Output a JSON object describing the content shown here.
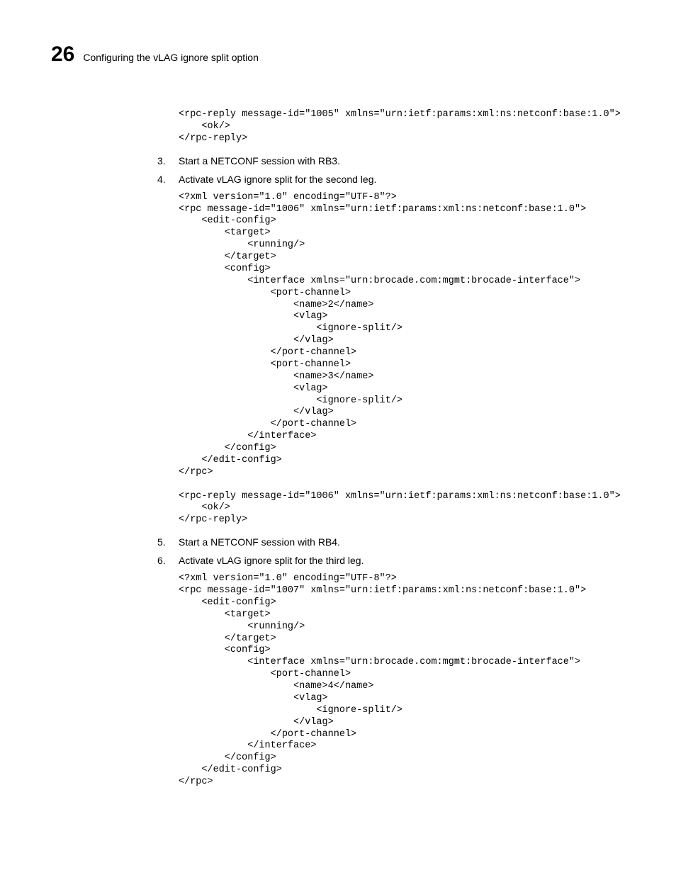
{
  "header": {
    "chapter_number": "26",
    "chapter_title": "Configuring the vLAG ignore split option"
  },
  "code_block_1": "<rpc-reply message-id=\"1005\" xmlns=\"urn:ietf:params:xml:ns:netconf:base:1.0\">\n    <ok/>\n</rpc-reply>",
  "step3": {
    "num": "3.",
    "text": "Start a NETCONF session with RB3."
  },
  "step4": {
    "num": "4.",
    "text": "Activate vLAG ignore split for the second leg."
  },
  "code_block_2": "<?xml version=\"1.0\" encoding=\"UTF-8\"?>\n<rpc message-id=\"1006\" xmlns=\"urn:ietf:params:xml:ns:netconf:base:1.0\">\n    <edit-config>\n        <target>\n            <running/>\n        </target>\n        <config>\n            <interface xmlns=\"urn:brocade.com:mgmt:brocade-interface\">\n                <port-channel>\n                    <name>2</name>\n                    <vlag>\n                        <ignore-split/>\n                    </vlag>\n                </port-channel>\n                <port-channel>\n                    <name>3</name>\n                    <vlag>\n                        <ignore-split/>\n                    </vlag>\n                </port-channel>\n            </interface>\n        </config>\n    </edit-config>\n</rpc>\n\n<rpc-reply message-id=\"1006\" xmlns=\"urn:ietf:params:xml:ns:netconf:base:1.0\">\n    <ok/>\n</rpc-reply>",
  "step5": {
    "num": "5.",
    "text": "Start a NETCONF session with RB4."
  },
  "step6": {
    "num": "6.",
    "text": "Activate vLAG ignore split for the third leg."
  },
  "code_block_3": "<?xml version=\"1.0\" encoding=\"UTF-8\"?>\n<rpc message-id=\"1007\" xmlns=\"urn:ietf:params:xml:ns:netconf:base:1.0\">\n    <edit-config>\n        <target>\n            <running/>\n        </target>\n        <config>\n            <interface xmlns=\"urn:brocade.com:mgmt:brocade-interface\">\n                <port-channel>\n                    <name>4</name>\n                    <vlag>\n                        <ignore-split/>\n                    </vlag>\n                </port-channel>\n            </interface>\n        </config>\n    </edit-config>\n</rpc>"
}
